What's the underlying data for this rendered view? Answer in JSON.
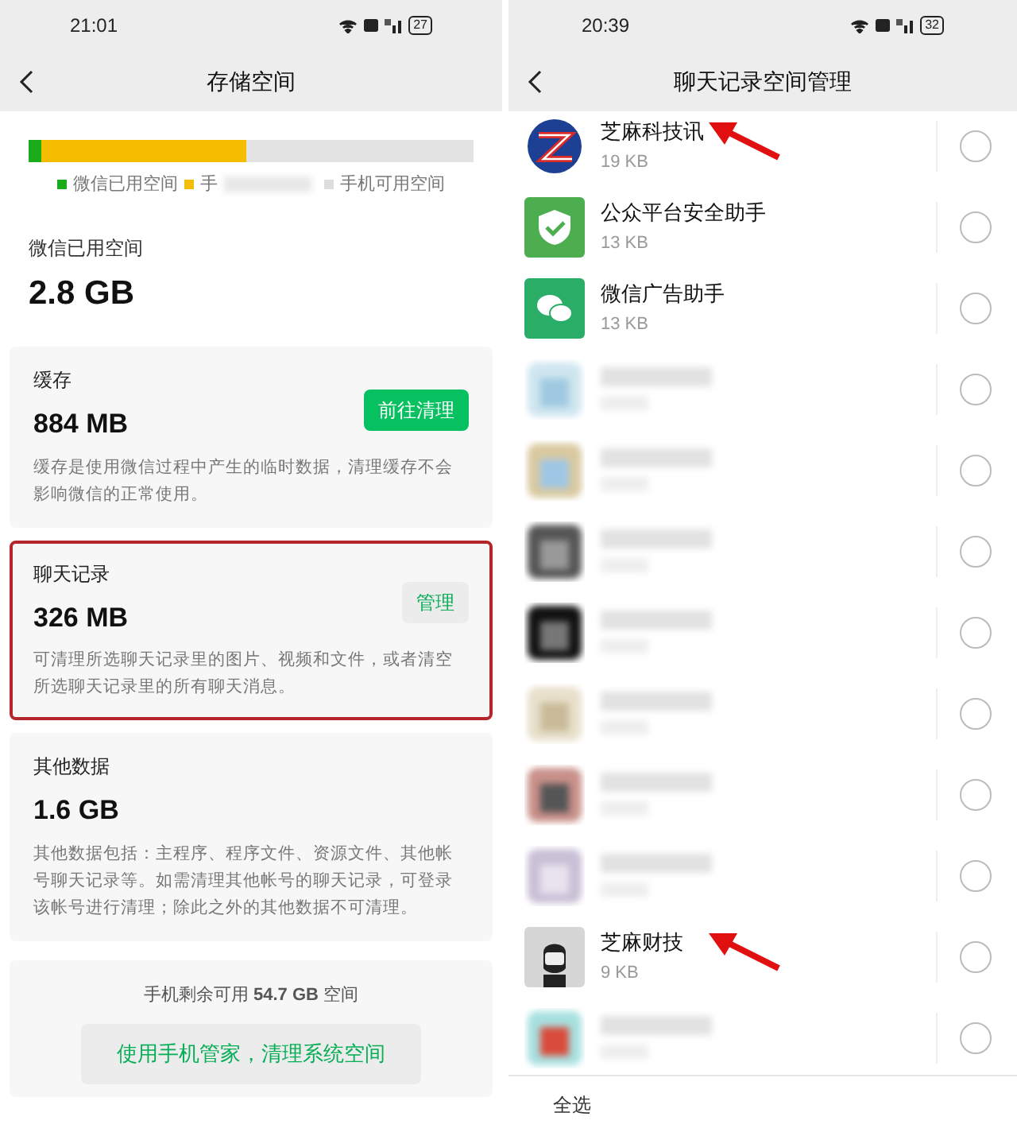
{
  "left": {
    "status_bar": {
      "time": "21:01",
      "battery": "27"
    },
    "title": "存储空间",
    "usage_bar": {
      "segments": [
        {
          "color": "#1aad19",
          "level": 0.03
        },
        {
          "color": "#f5bd00",
          "level": 0.49
        }
      ]
    },
    "legend": [
      {
        "color": "#1aad19",
        "label": "微信已用空间",
        "redacted": false
      },
      {
        "color": "#f5bd00",
        "label": "手",
        "redacted": true
      },
      {
        "color": "#dddddd",
        "label": "手机可用空间",
        "redacted": false
      }
    ],
    "used": {
      "label": "微信已用空间",
      "value": "2.8 GB"
    },
    "cards": [
      {
        "title": "缓存",
        "value": "884 MB",
        "button": "前往清理",
        "kind": "primary",
        "highlighted": false,
        "description": "缓存是使用微信过程中产生的临时数据，清理缓存不会影响微信的正常使用。"
      },
      {
        "title": "聊天记录",
        "value": "326 MB",
        "button": "管理",
        "kind": "secondary",
        "highlighted": true,
        "description": "可清理所选聊天记录里的图片、视频和文件，或者清空所选聊天记录里的所有聊天消息。"
      },
      {
        "title": "其他数据",
        "value": "1.6 GB",
        "highlighted": false,
        "description": "其他数据包括：主程序、程序文件、资源文件、其他帐号聊天记录等。如需清理其他帐号的聊天记录，可登录该帐号进行清理；除此之外的其他数据不可清理。"
      }
    ],
    "footer": {
      "free_text": "手机剩余可用 **54.7 GB** 空间",
      "button": "使用手机管家，清理系统空间"
    }
  },
  "right": {
    "status_bar": {
      "time": "20:39",
      "battery": "32"
    },
    "title": "聊天记录空间管理",
    "rows": [
      {
        "kind": "zlogo",
        "name": "芝麻科技讯",
        "size": "19 KB",
        "selected": false,
        "arrow": true
      },
      {
        "kind": "shield",
        "name": "公众平台安全助手",
        "size": "13 KB",
        "selected": false,
        "arrow": false
      },
      {
        "kind": "wechat",
        "name": "微信广告助手",
        "size": "13 KB",
        "selected": false,
        "arrow": false
      },
      {
        "kind": "blurred",
        "selected": false,
        "arrow": false
      },
      {
        "kind": "blurred",
        "selected": false,
        "arrow": false
      },
      {
        "kind": "blurred",
        "selected": false,
        "arrow": false
      },
      {
        "kind": "blurred",
        "selected": false,
        "arrow": false
      },
      {
        "kind": "blurred",
        "selected": false,
        "arrow": false
      },
      {
        "kind": "blurred",
        "selected": false,
        "arrow": false
      },
      {
        "kind": "blurred",
        "selected": false,
        "arrow": false
      },
      {
        "kind": "person",
        "name": "芝麻财技",
        "size": "9 KB",
        "selected": false,
        "arrow": true
      },
      {
        "kind": "blurred",
        "selected": false,
        "arrow": false
      }
    ],
    "select_all": "全选"
  }
}
